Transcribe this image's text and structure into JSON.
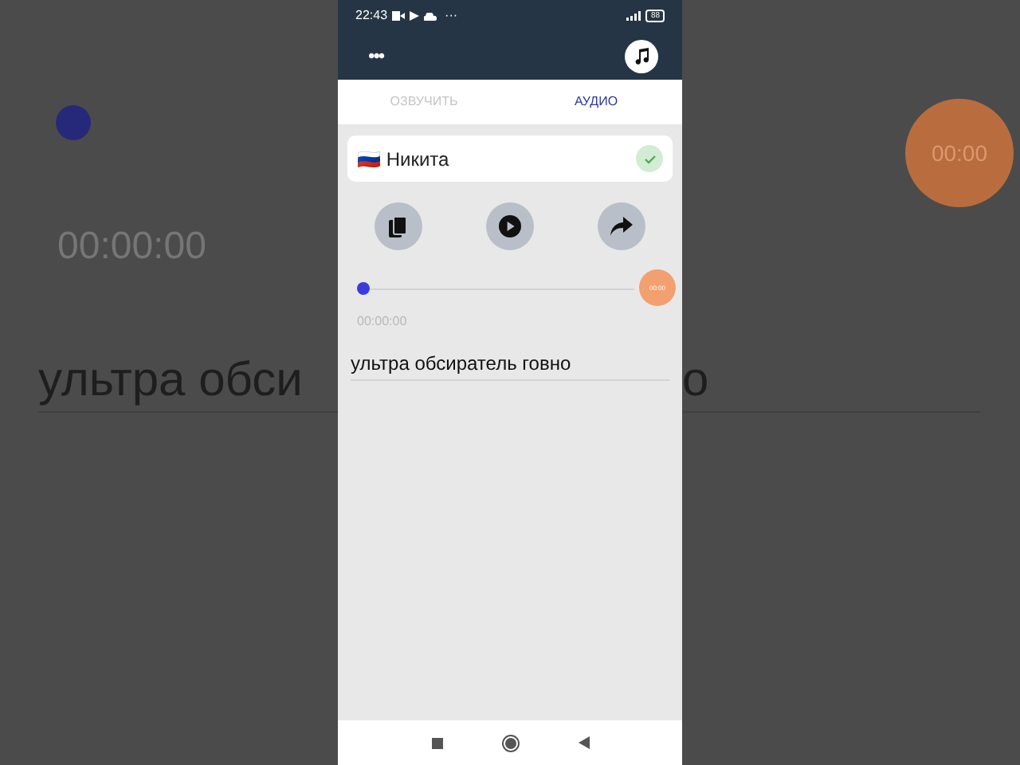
{
  "backdrop": {
    "time": "00:00:00",
    "badge": "00:00",
    "text_left": "ультра обси",
    "text_right": "о"
  },
  "status_bar": {
    "time": "22:43",
    "more": "···",
    "battery": "88"
  },
  "header": {
    "menu": "•••"
  },
  "tabs": [
    {
      "label": "ОЗВУЧИТЬ",
      "selected": false
    },
    {
      "label": "АУДИО",
      "selected": true
    }
  ],
  "voice": {
    "flag": "🇷🇺",
    "name": "Никита",
    "checked": true
  },
  "player": {
    "level": 0,
    "badge": "00:00",
    "time": "00:00:00"
  },
  "text_field": {
    "value": "ультра обсиратель говно"
  }
}
